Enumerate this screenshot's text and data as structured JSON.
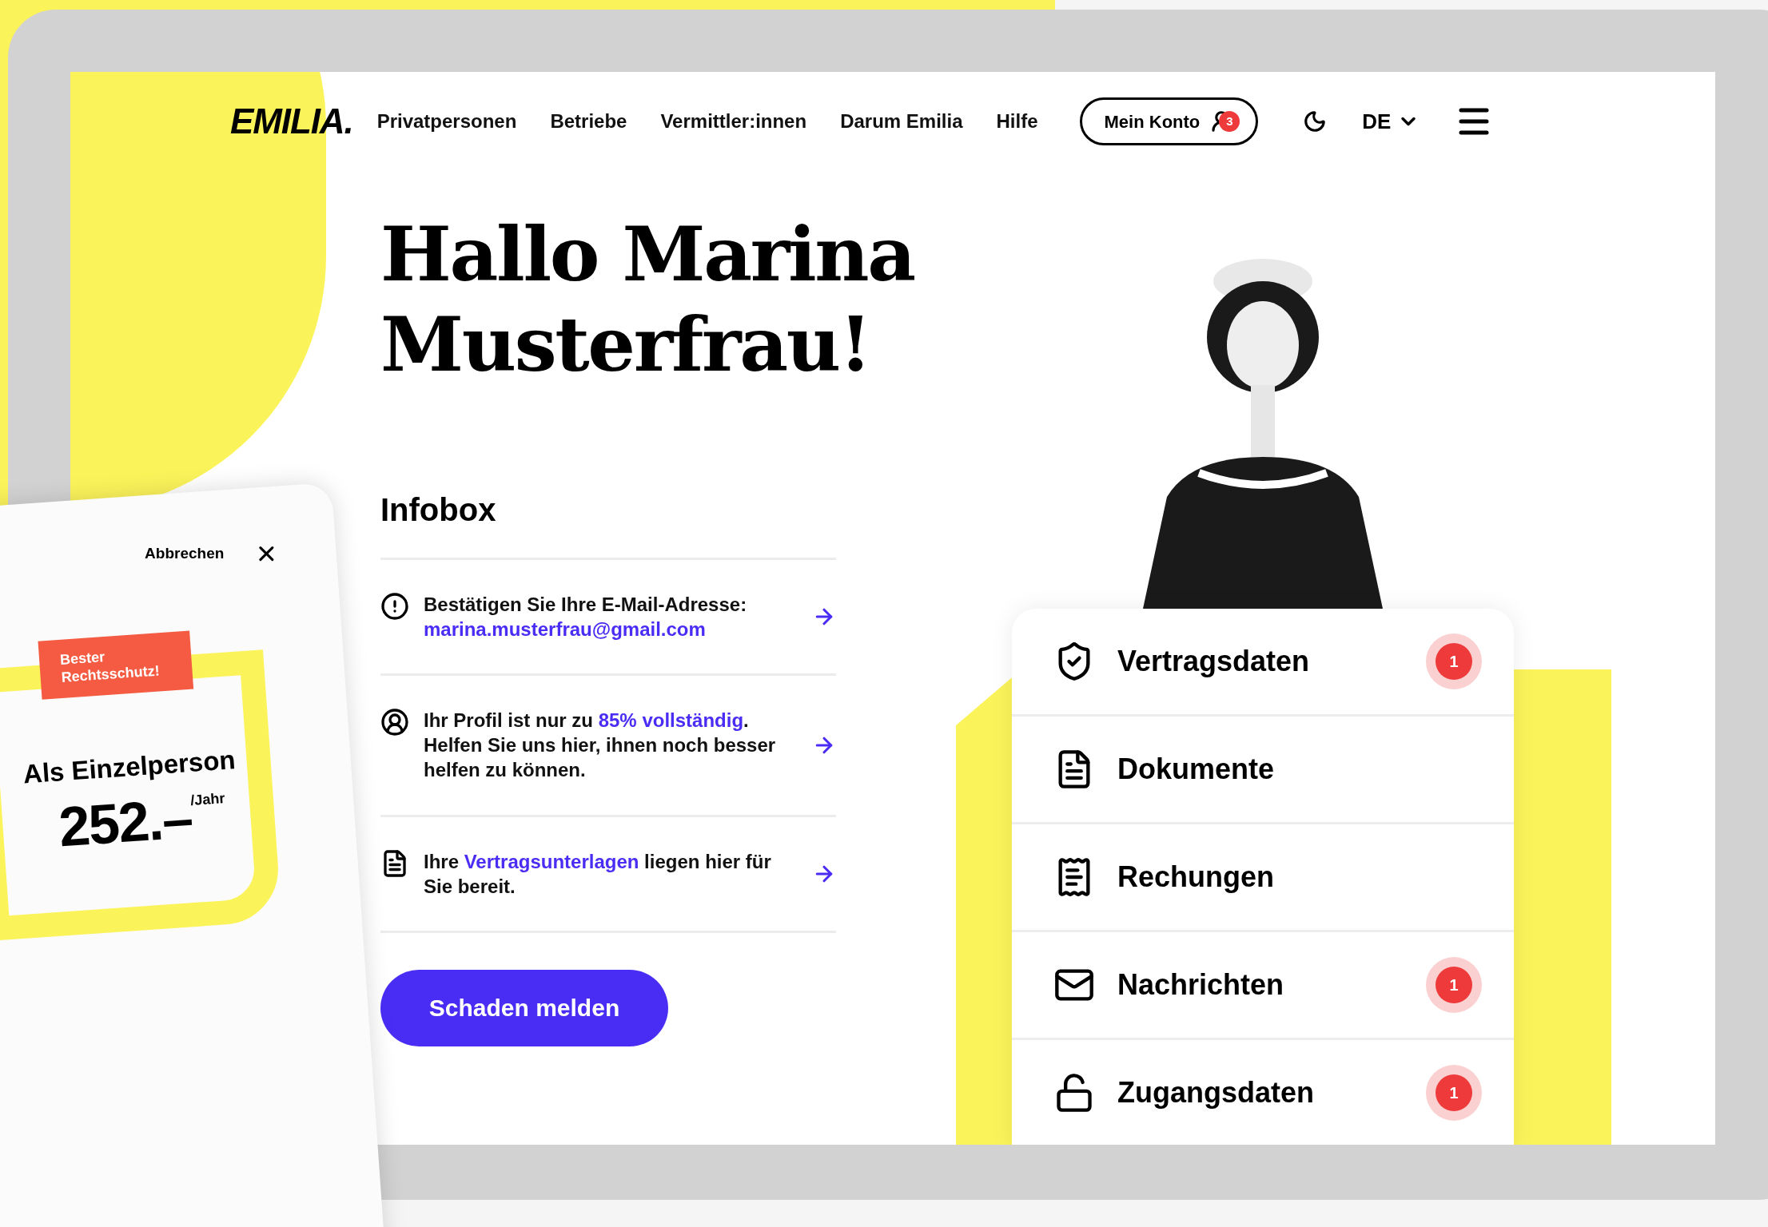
{
  "nav": {
    "logo": "EMILIA.",
    "links": [
      "Privatpersonen",
      "Betriebe",
      "Vermittler:innen",
      "Darum Emilia",
      "Hilfe"
    ],
    "account": {
      "label": "Mein Konto",
      "badge": "3"
    },
    "language": "DE"
  },
  "greeting": "Hallo Marina Musterfrau!",
  "infobox": {
    "title": "Infobox",
    "items": [
      {
        "kind": "alert",
        "parts": [
          {
            "text": "Bestätigen Sie Ihre E-Mail-Adresse: ",
            "link": false
          },
          {
            "text": "marina.musterfrau@gmail.com",
            "link": true
          }
        ]
      },
      {
        "kind": "profile",
        "parts": [
          {
            "text": "Ihr Profil ist nur zu ",
            "link": false
          },
          {
            "text": "85% vollständig",
            "link": true
          },
          {
            "text": ". Helfen Sie uns hier, ihnen noch besser helfen zu können.",
            "link": false
          }
        ]
      },
      {
        "kind": "document",
        "parts": [
          {
            "text": "Ihre ",
            "link": false
          },
          {
            "text": "Vertragsunterlagen",
            "link": true
          },
          {
            "text": " liegen hier für Sie bereit.",
            "link": false
          }
        ]
      }
    ]
  },
  "report_button": "Schaden melden",
  "menu": [
    {
      "kind": "shield",
      "label": "Vertragsdaten",
      "badge": "1"
    },
    {
      "kind": "document",
      "label": "Dokumente"
    },
    {
      "kind": "invoice",
      "label": "Rechungen"
    },
    {
      "kind": "mail",
      "label": "Nachrichten",
      "badge": "1"
    },
    {
      "kind": "lock",
      "label": "Zugangsdaten",
      "badge": "1"
    }
  ],
  "offer_card": {
    "cancel": "Abbrechen",
    "ribbon": "Bester Rechtsschutz!",
    "title": "Als Einzelperson",
    "price": "252.–",
    "unit": "/Jahr"
  }
}
